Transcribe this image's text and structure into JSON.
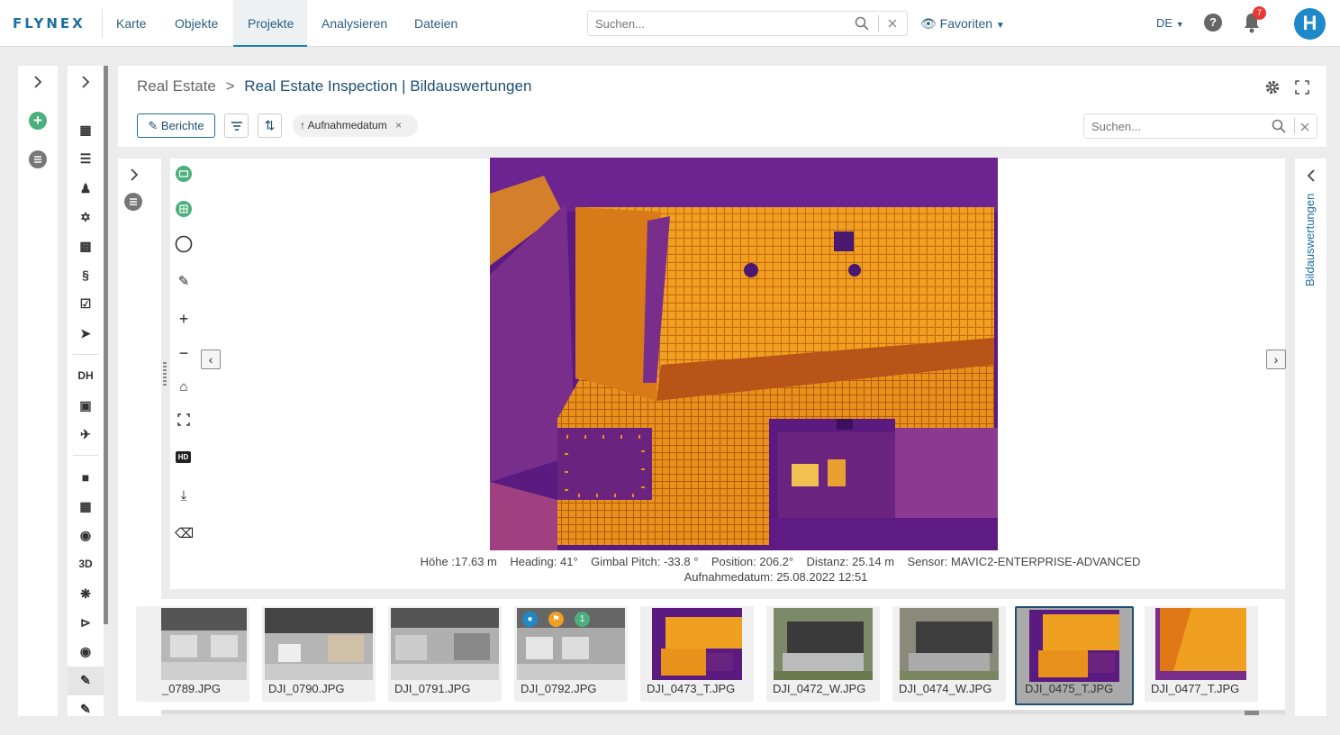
{
  "app": {
    "logo": "FLYNEX"
  },
  "nav": {
    "items": [
      "Karte",
      "Objekte",
      "Projekte",
      "Analysieren",
      "Dateien"
    ],
    "active": "Projekte"
  },
  "top_search": {
    "placeholder": "Suchen..."
  },
  "favorites_label": "Favoriten",
  "language": "DE",
  "help_label": "?",
  "notification_count": "7",
  "rail2_labels": {
    "dh": "DH",
    "three_d": "3D"
  },
  "breadcrumb": {
    "parent": "Real Estate",
    "separator": ">",
    "current": "Real Estate Inspection | Bildauswertungen"
  },
  "toolbar": {
    "berichte_label": "Berichte",
    "sort_chip_label": "Aufnahmedatum"
  },
  "header_search": {
    "placeholder": "Suchen..."
  },
  "right_panel_label": "Bildauswertungen",
  "viewer_tools": {
    "hd_label": "HD"
  },
  "image_meta": {
    "line1": "Höhe :17.63 m    Heading: 41°    Gimbal Pitch: -33.8 °    Position: 206.2°    Distanz: 25.14 m    Sensor: MAVIC2-ENTERPRISE-ADVANCED",
    "line2": "Aufnahmedatum: 25.08.2022 12:51"
  },
  "thumbnails": [
    {
      "label": "_0789.JPG",
      "kind": "rgb"
    },
    {
      "label": "DJI_0790.JPG",
      "kind": "rgb"
    },
    {
      "label": "DJI_0791.JPG",
      "kind": "rgb"
    },
    {
      "label": "DJI_0792.JPG",
      "kind": "rgb",
      "badge": "1"
    },
    {
      "label": "DJI_0473_T.JPG",
      "kind": "thermal"
    },
    {
      "label": "DJI_0472_W.JPG",
      "kind": "wide"
    },
    {
      "label": "DJI_0474_W.JPG",
      "kind": "wide"
    },
    {
      "label": "DJI_0475_T.JPG",
      "kind": "thermal",
      "selected": true
    },
    {
      "label": "DJI_0477_T.JPG",
      "kind": "thermal"
    }
  ],
  "colors": {
    "brand": "#1e6e9e",
    "accent_green": "#4caf7d",
    "notification": "#e53935"
  }
}
